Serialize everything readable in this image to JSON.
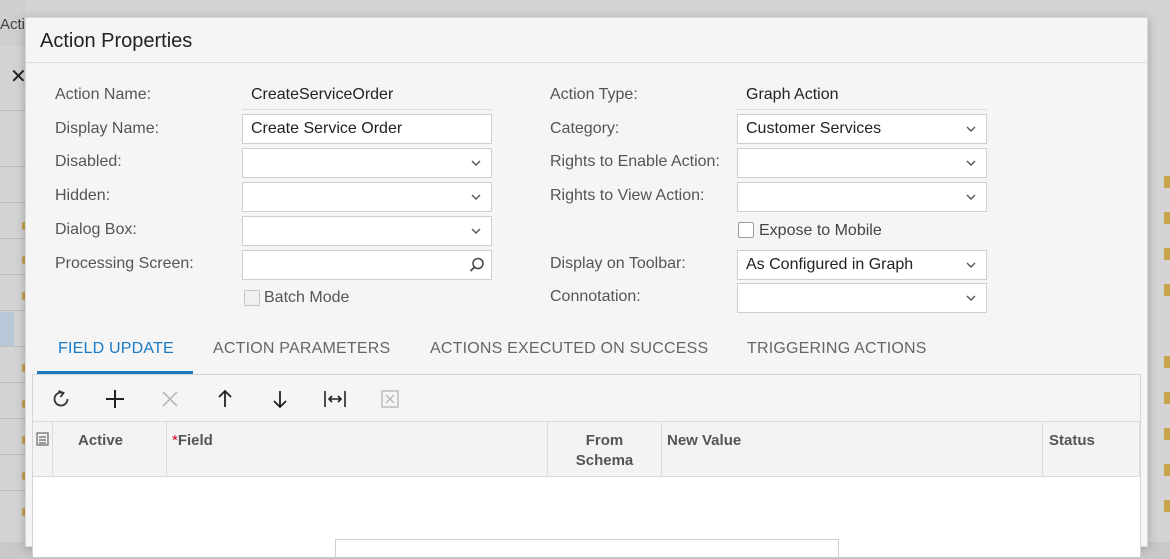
{
  "background": {
    "tab_fragment": "Actio"
  },
  "dialog": {
    "title": "Action Properties",
    "left": {
      "action_name_label": "Action Name:",
      "action_name_value": "CreateServiceOrder",
      "display_name_label": "Display Name:",
      "display_name_value": "Create Service Order",
      "disabled_label": "Disabled:",
      "disabled_value": "",
      "hidden_label": "Hidden:",
      "hidden_value": "",
      "dialog_box_label": "Dialog Box:",
      "dialog_box_value": "",
      "processing_screen_label": "Processing Screen:",
      "processing_screen_value": "",
      "batch_mode_label": "Batch Mode"
    },
    "right": {
      "action_type_label": "Action Type:",
      "action_type_value": "Graph Action",
      "category_label": "Category:",
      "category_value": "Customer Services",
      "rights_enable_label": "Rights to Enable Action:",
      "rights_enable_value": "",
      "rights_view_label": "Rights to View Action:",
      "rights_view_value": "",
      "expose_mobile_label": "Expose to Mobile",
      "display_toolbar_label": "Display on Toolbar:",
      "display_toolbar_value": "As Configured in Graph",
      "connotation_label": "Connotation:",
      "connotation_value": ""
    },
    "tabs": [
      {
        "label": "FIELD UPDATE",
        "active": true
      },
      {
        "label": "ACTION PARAMETERS",
        "active": false
      },
      {
        "label": "ACTIONS EXECUTED ON SUCCESS",
        "active": false
      },
      {
        "label": "TRIGGERING ACTIONS",
        "active": false
      }
    ],
    "toolbar_icons": [
      "refresh-icon",
      "add-icon",
      "delete-icon",
      "move-up-icon",
      "move-down-icon",
      "fit-columns-icon",
      "export-excel-icon"
    ],
    "grid": {
      "columns": [
        {
          "label": "Active"
        },
        {
          "label": "Field",
          "required": true
        },
        {
          "label_line1": "From",
          "label_line2": "Schema"
        },
        {
          "label": "New Value"
        },
        {
          "label": "Status"
        }
      ],
      "rows": []
    }
  },
  "colors": {
    "accent": "#1a7ac4",
    "required": "#d0021b"
  }
}
